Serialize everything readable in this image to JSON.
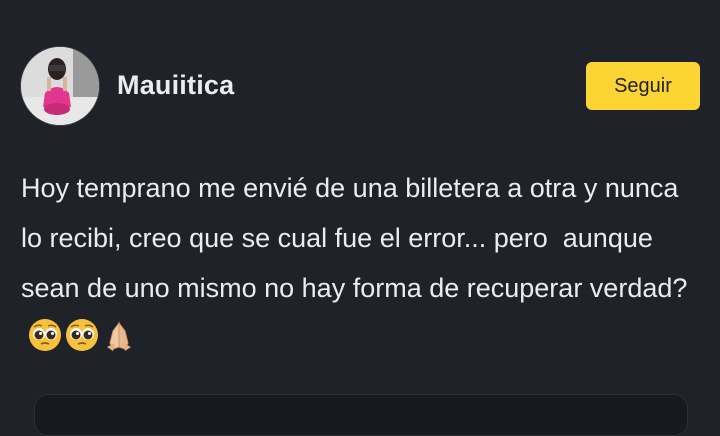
{
  "author": {
    "name": "Mauiitica",
    "follow_label": "Seguir"
  },
  "post": {
    "text": "Hoy temprano me envié de una billetera a otra y nunca lo recibi, creo que se cual fue el error... pero  aunque sean de uno mismo no hay forma de recuperar verdad?",
    "emojis": [
      "pleading-face-icon",
      "pleading-face-icon",
      "folded-hands-icon"
    ]
  },
  "colors": {
    "background": "#1f2229",
    "accent": "#fcd535",
    "text": "#eaecef"
  }
}
